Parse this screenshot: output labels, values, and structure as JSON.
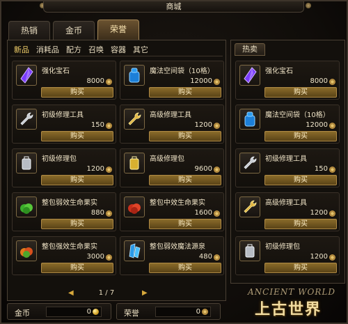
{
  "window": {
    "title": "商城"
  },
  "tabs": [
    {
      "label": "热销",
      "active": false
    },
    {
      "label": "金币",
      "active": false
    },
    {
      "label": "荣誉",
      "active": true
    }
  ],
  "subnav": [
    "新品",
    "消耗品",
    "配方",
    "召唤",
    "容器",
    "其它"
  ],
  "subnav_active": "新品",
  "buy_label": "购买",
  "items": [
    {
      "name": "强化宝石",
      "price": "8000",
      "icon": "purple-gem-icon"
    },
    {
      "name": "魔法空间袋（10格）",
      "price": "12000",
      "icon": "blue-bag-icon"
    },
    {
      "name": "初级修理工具",
      "price": "150",
      "icon": "silver-wrench-icon"
    },
    {
      "name": "高级修理工具",
      "price": "1200",
      "icon": "gold-wrench-icon"
    },
    {
      "name": "初级修理包",
      "price": "1200",
      "icon": "silver-repair-kit-icon"
    },
    {
      "name": "高级修理包",
      "price": "9600",
      "icon": "gold-repair-kit-icon"
    },
    {
      "name": "整包弱效生命果实",
      "price": "880",
      "icon": "green-fruit-icon"
    },
    {
      "name": "整包中效生命果实",
      "price": "1600",
      "icon": "red-fruit-icon"
    },
    {
      "name": "整包强效生命果实",
      "price": "3000",
      "icon": "orange-fruit-icon"
    },
    {
      "name": "整包弱效魔法源泉",
      "price": "480",
      "icon": "blue-crystal-icon"
    }
  ],
  "pager": {
    "text": "1 / 7"
  },
  "hot": {
    "tab_label": "热卖",
    "items": [
      {
        "name": "强化宝石",
        "price": "8000",
        "icon": "purple-gem-icon"
      },
      {
        "name": "魔法空间袋（10格）",
        "price": "12000",
        "icon": "blue-bag-icon"
      },
      {
        "name": "初级修理工具",
        "price": "150",
        "icon": "silver-wrench-icon"
      },
      {
        "name": "高级修理工具",
        "price": "1200",
        "icon": "gold-wrench-icon"
      },
      {
        "name": "初级修理包",
        "price": "1200",
        "icon": "silver-repair-kit-icon"
      }
    ]
  },
  "currency": {
    "gold_label": "金币",
    "gold_value": "0",
    "honor_label": "荣誉",
    "honor_value": "0"
  },
  "logo": {
    "en": "ANCIENT WORLD",
    "cn": "上古世界"
  },
  "colors": {
    "accent": "#f5d26b",
    "buy_button": "#7a5c22",
    "border": "#4a4034"
  }
}
